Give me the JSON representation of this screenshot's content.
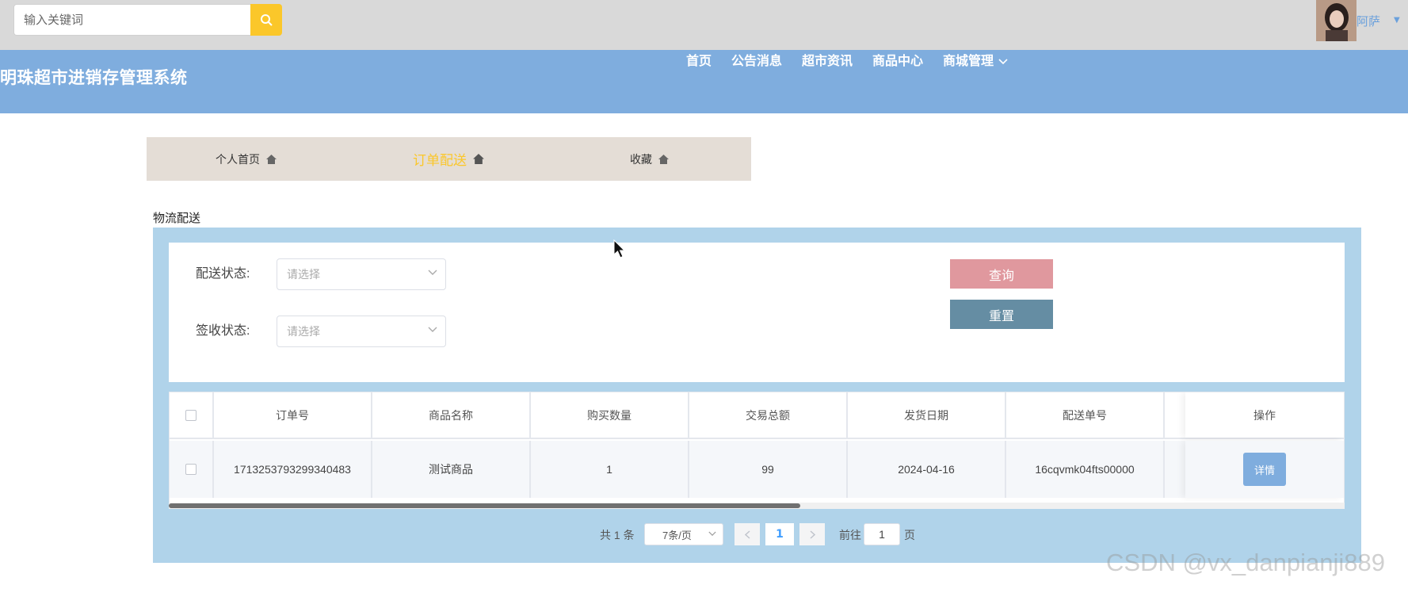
{
  "search": {
    "placeholder": "输入关键词"
  },
  "user": {
    "name": "阿萨"
  },
  "header": {
    "site_title": "明珠超市进销存管理系统",
    "nav": [
      "首页",
      "公告消息",
      "超市资讯",
      "商品中心",
      "商城管理"
    ]
  },
  "user_tabs": [
    {
      "label": "个人首页",
      "active": false
    },
    {
      "label": "订单配送",
      "active": true
    },
    {
      "label": "收藏",
      "active": false
    }
  ],
  "section": {
    "title": "物流配送"
  },
  "filters": {
    "delivery_status": {
      "label": "配送状态:",
      "placeholder": "请选择"
    },
    "sign_status": {
      "label": "签收状态:",
      "placeholder": "请选择"
    },
    "query_label": "查询",
    "reset_label": "重置"
  },
  "table": {
    "columns": [
      "订单号",
      "商品名称",
      "购买数量",
      "交易总额",
      "发货日期",
      "配送单号",
      "操作"
    ],
    "rows": [
      {
        "order_no": "1713253793299340483",
        "product": "测试商品",
        "qty": "1",
        "total": "99",
        "ship_date": "2024-04-16",
        "delivery_no": "16cqvmk04fts00000",
        "action_label": "详情"
      }
    ]
  },
  "pagination": {
    "total_text": "共 1 条",
    "page_size": "7条/页",
    "current_page": "1",
    "goto_prefix": "前往",
    "goto_value": "1",
    "goto_suffix": "页"
  },
  "watermark": "CSDN @vx_danpianji889",
  "colors": {
    "topbar": "#d9d9d9",
    "nav": "#7fadde",
    "search_button": "#fbc72a",
    "active_tab": "#fbc72a",
    "panel": "#b0d3ea",
    "query_button": "#e0989e",
    "reset_button": "#658da3",
    "detail_button": "#7fadde"
  }
}
